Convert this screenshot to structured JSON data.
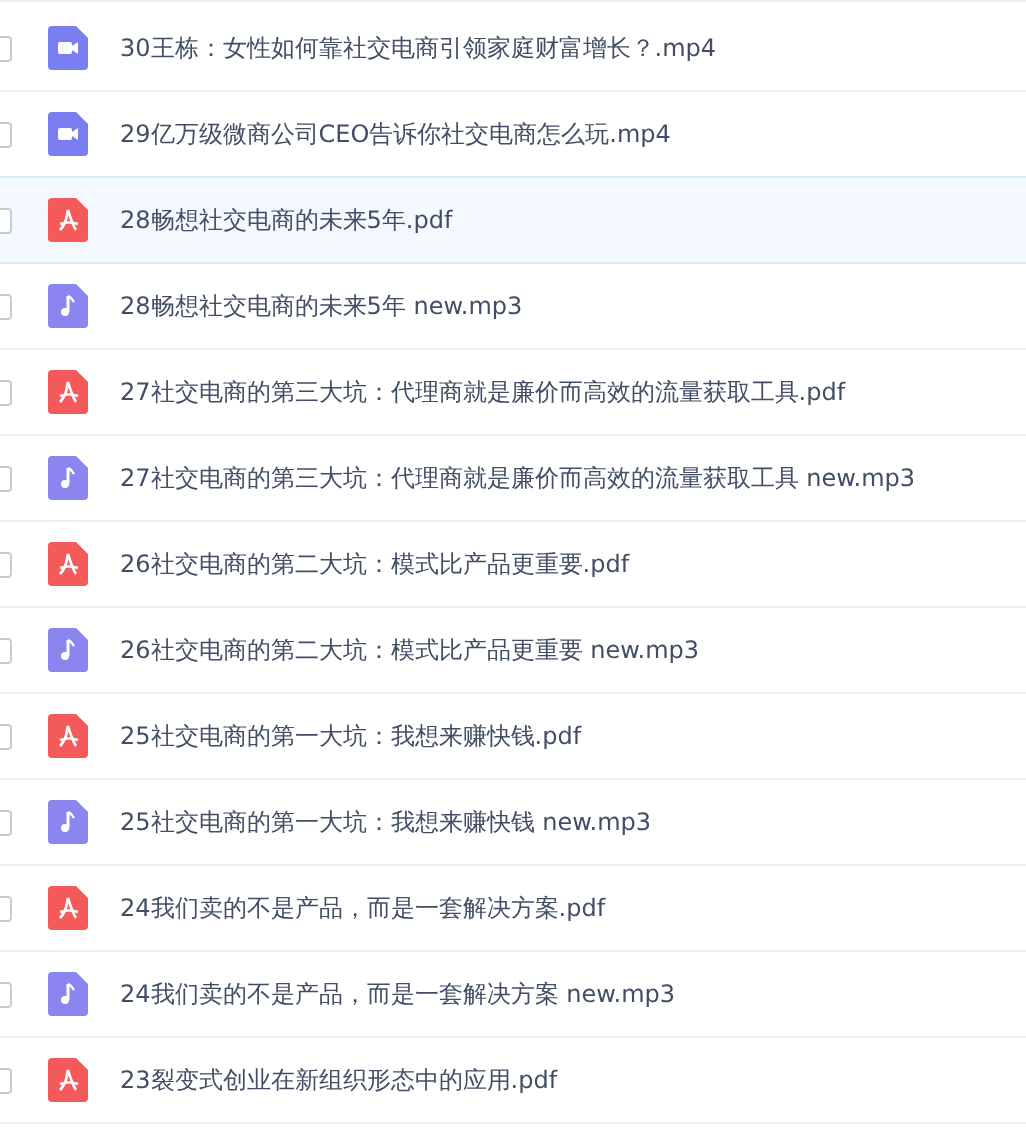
{
  "files": [
    {
      "kind": "video",
      "name": "30王栋：女性如何靠社交电商引领家庭财富增长？.mp4",
      "selected": false
    },
    {
      "kind": "video",
      "name": "29亿万级微商公司CEO告诉你社交电商怎么玩.mp4",
      "selected": false
    },
    {
      "kind": "pdf",
      "name": "28畅想社交电商的未来5年.pdf",
      "selected": true
    },
    {
      "kind": "audio",
      "name": "28畅想社交电商的未来5年 new.mp3",
      "selected": false
    },
    {
      "kind": "pdf",
      "name": "27社交电商的第三大坑：代理商就是廉价而高效的流量获取工具.pdf",
      "selected": false
    },
    {
      "kind": "audio",
      "name": "27社交电商的第三大坑：代理商就是廉价而高效的流量获取工具 new.mp3",
      "selected": false
    },
    {
      "kind": "pdf",
      "name": "26社交电商的第二大坑：模式比产品更重要.pdf",
      "selected": false
    },
    {
      "kind": "audio",
      "name": "26社交电商的第二大坑：模式比产品更重要 new.mp3",
      "selected": false
    },
    {
      "kind": "pdf",
      "name": "25社交电商的第一大坑：我想来赚快钱.pdf",
      "selected": false
    },
    {
      "kind": "audio",
      "name": "25社交电商的第一大坑：我想来赚快钱 new.mp3",
      "selected": false
    },
    {
      "kind": "pdf",
      "name": "24我们卖的不是产品，而是一套解决方案.pdf",
      "selected": false
    },
    {
      "kind": "audio",
      "name": "24我们卖的不是产品，而是一套解决方案 new.mp3",
      "selected": false
    },
    {
      "kind": "pdf",
      "name": "23裂变式创业在新组织形态中的应用.pdf",
      "selected": false
    }
  ]
}
